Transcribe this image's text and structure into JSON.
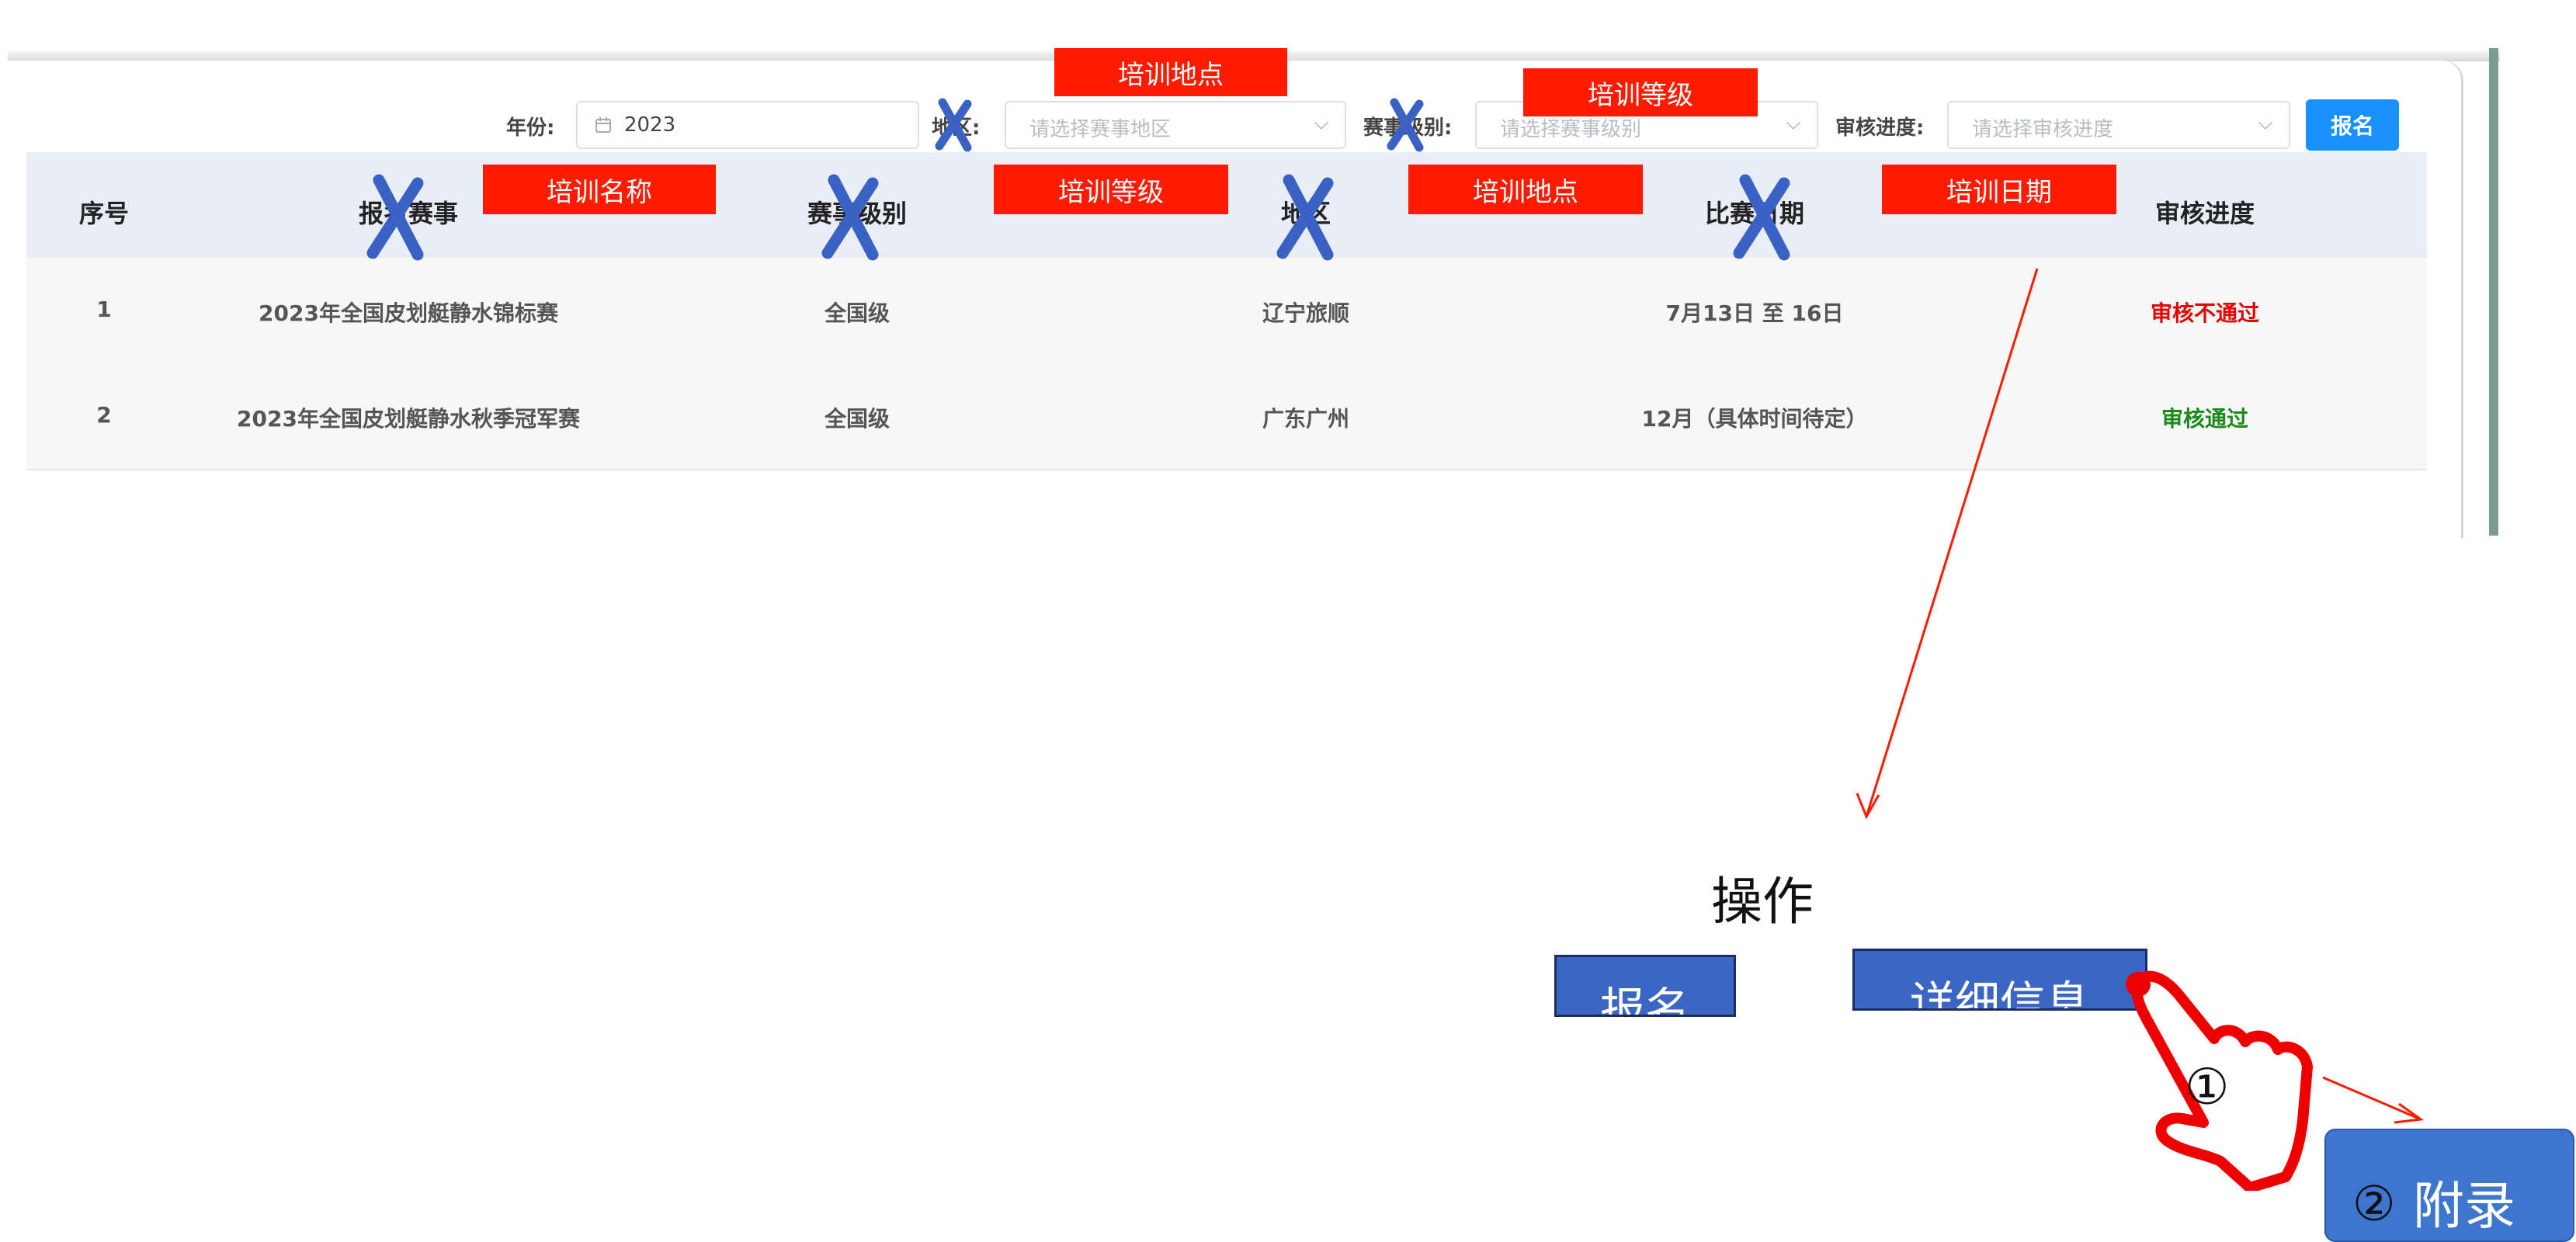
{
  "filters": {
    "year_label": "年份:",
    "year_value": "2023",
    "region_label": "地区:",
    "region_placeholder": "请选择赛事地区",
    "level_label": "赛事级别:",
    "level_placeholder": "请选择赛事级别",
    "review_label": "审核进度:",
    "review_placeholder": "请选择审核进度",
    "signup_button": "报名"
  },
  "table": {
    "headers": [
      "序号",
      "报名赛事",
      "赛事级别",
      "地区",
      "比赛日期",
      "审核进度"
    ],
    "rows": [
      [
        "1",
        "2023年全国皮划艇静水锦标赛",
        "全国级",
        "辽宁旅顺",
        "7月13日 至 16日",
        "审核不通过"
      ],
      [
        "2",
        "2023年全国皮划艇静水秋季冠军赛",
        "全国级",
        "广东广州",
        "12月（具体时间待定）",
        "审核通过"
      ]
    ]
  },
  "annotations": {
    "filter_region_replacement": "培训地点",
    "filter_level_replacement": "培训等级",
    "col_event_replacement": "培训名称",
    "col_level_replacement": "培训等级",
    "col_region_replacement": "培训地点",
    "col_date_replacement": "培训日期",
    "step_one_marker": "①",
    "step_two_marker": "②"
  },
  "operation": {
    "title": "操作",
    "signup_button": "报名",
    "details_button": "详细信息",
    "appendix_button": "附录"
  },
  "colors": {
    "primary_button": "#1890ff",
    "annotation_red": "#ff1a00",
    "cross_blue": "#3a62c4",
    "status_fail": "#e60000",
    "status_pass": "#1b8a1b"
  }
}
